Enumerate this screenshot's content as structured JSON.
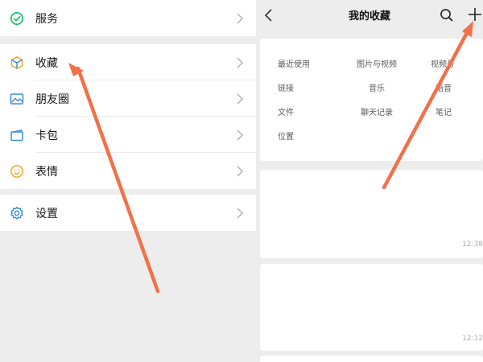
{
  "left_menu": {
    "group1": [
      {
        "label": "服务",
        "icon": "wallet-check-icon"
      }
    ],
    "group2": [
      {
        "label": "收藏",
        "icon": "cube-icon"
      },
      {
        "label": "朋友圈",
        "icon": "image-icon"
      },
      {
        "label": "卡包",
        "icon": "card-icon"
      },
      {
        "label": "表情",
        "icon": "smile-icon"
      }
    ],
    "group3": [
      {
        "label": "设置",
        "icon": "gear-icon"
      }
    ]
  },
  "favorites": {
    "title": "我的收藏",
    "filters": [
      "最近使用",
      "图片与视频",
      "视频号",
      "链接",
      "音乐",
      "语音",
      "文件",
      "聊天记录",
      "笔记",
      "位置"
    ],
    "items": [
      {
        "time": "12:38"
      },
      {
        "time": "12:12"
      }
    ]
  },
  "colors": {
    "accent": "#07c160",
    "annotation_arrow": "#f0714a",
    "icon_orange": "#f5a623",
    "icon_blue": "#3b8fd8"
  }
}
